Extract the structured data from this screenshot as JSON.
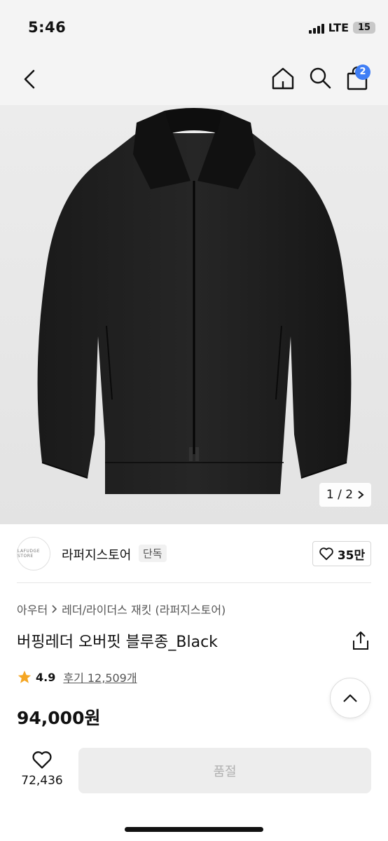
{
  "status_bar": {
    "time": "5:46",
    "network": "LTE",
    "battery": "15"
  },
  "nav": {
    "cart_count": "2"
  },
  "image": {
    "counter": "1 / 2"
  },
  "store": {
    "name": "라퍼지스토어",
    "badge": "단독",
    "logo_text": "LAFUDGE STORE",
    "likes": "35만"
  },
  "breadcrumb": {
    "category": "아우터",
    "subcategory": "레더/라이더스 재킷 (라퍼지스토어)"
  },
  "product": {
    "title": "버핑레더 오버핏 블루종_Black",
    "rating": "4.9",
    "reviews": "후기 12,509개",
    "price": "94,000원"
  },
  "bottom": {
    "wish_count": "72,436",
    "soldout_label": "품절"
  },
  "colors": {
    "accent": "#3f7ef5",
    "star": "#f5a623",
    "soldout_bg": "#ededed"
  }
}
